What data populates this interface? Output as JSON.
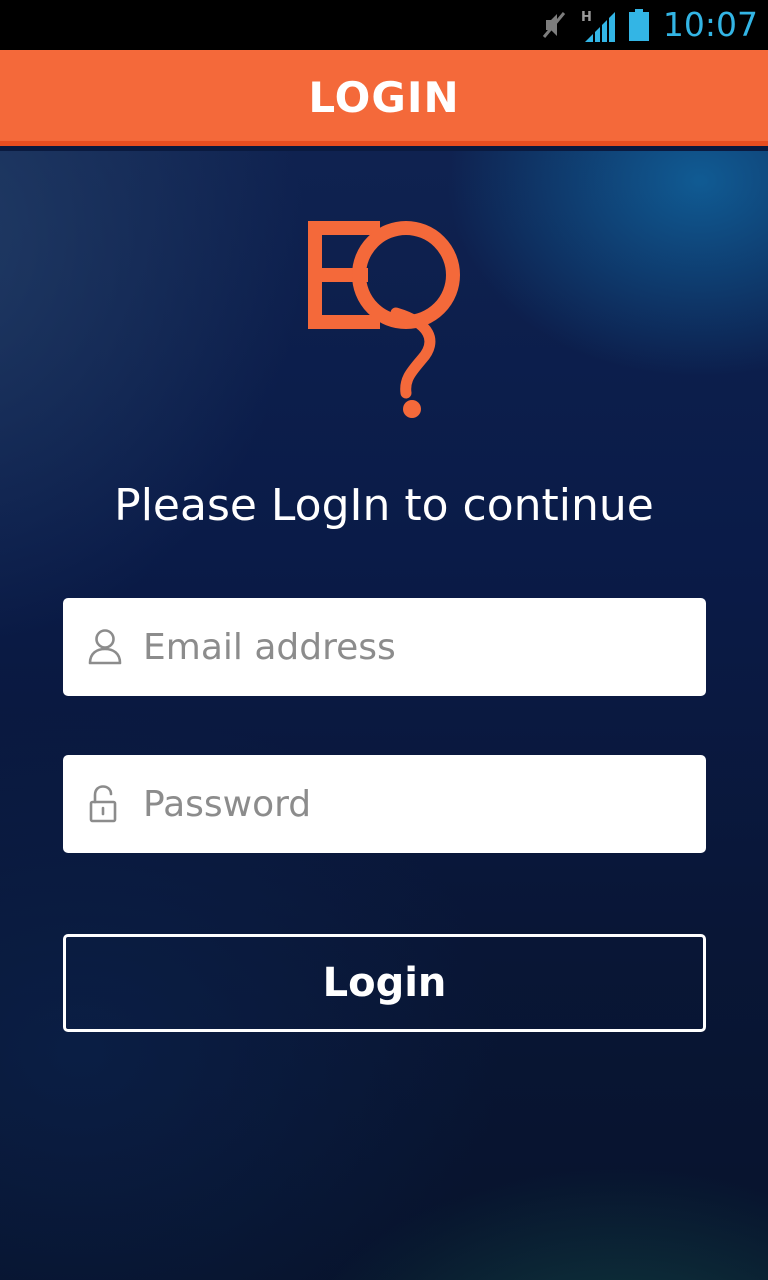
{
  "status_bar": {
    "time": "10:07",
    "network_type": "H",
    "icons": [
      "muted-icon",
      "signal-icon",
      "battery-icon"
    ],
    "clock_color": "#33b5e5"
  },
  "app_bar": {
    "title": "LOGIN",
    "color": "#f4693a"
  },
  "logo": {
    "text": "EQ?",
    "color": "#f4693a"
  },
  "heading": "Please LogIn to continue",
  "form": {
    "email": {
      "placeholder": "Email address",
      "value": "",
      "icon": "user-icon"
    },
    "password": {
      "placeholder": "Password",
      "value": "",
      "icon": "lock-icon"
    },
    "submit_label": "Login"
  }
}
